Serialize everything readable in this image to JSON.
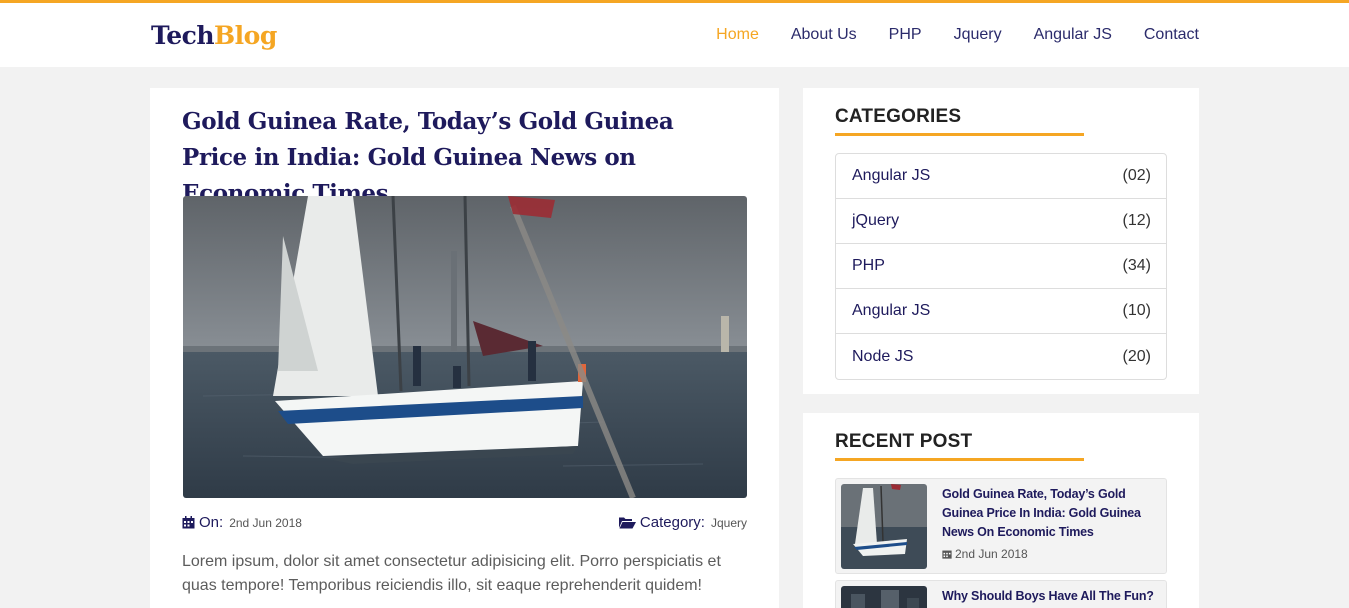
{
  "logo": {
    "part1": "Tech",
    "part2": "Blog"
  },
  "nav": [
    {
      "label": "Home",
      "active": true
    },
    {
      "label": "About Us"
    },
    {
      "label": "PHP"
    },
    {
      "label": "Jquery"
    },
    {
      "label": "Angular JS"
    },
    {
      "label": "Contact"
    }
  ],
  "post": {
    "title": "Gold Guinea Rate, Today’s Gold Guinea Price in India: Gold Guinea News on Economic Times",
    "on_label": "On:",
    "date": "2nd Jun 2018",
    "category_label": "Category:",
    "category": "Jquery",
    "excerpt": "Lorem ipsum, dolor sit amet consectetur adipisicing elit. Porro perspiciatis et quas tempore! Temporibus reiciendis illo, sit eaque reprehenderit quidem!"
  },
  "categories": {
    "heading": "CATEGORIES",
    "items": [
      {
        "name": "Angular JS",
        "count": "(02)"
      },
      {
        "name": "jQuery",
        "count": "(12)"
      },
      {
        "name": "PHP",
        "count": "(34)"
      },
      {
        "name": "Angular JS",
        "count": "(10)"
      },
      {
        "name": "Node JS",
        "count": "(20)"
      }
    ]
  },
  "recent": {
    "heading": "RECENT POST",
    "items": [
      {
        "title": "Gold Guinea Rate, Today’s Gold Guinea Price In India: Gold Guinea News On Economic Times",
        "date": "2nd Jun 2018"
      },
      {
        "title": "Why Should Boys Have All The Fun?"
      }
    ]
  },
  "colors": {
    "accent": "#f5a623",
    "navy": "#1e1a5c"
  }
}
